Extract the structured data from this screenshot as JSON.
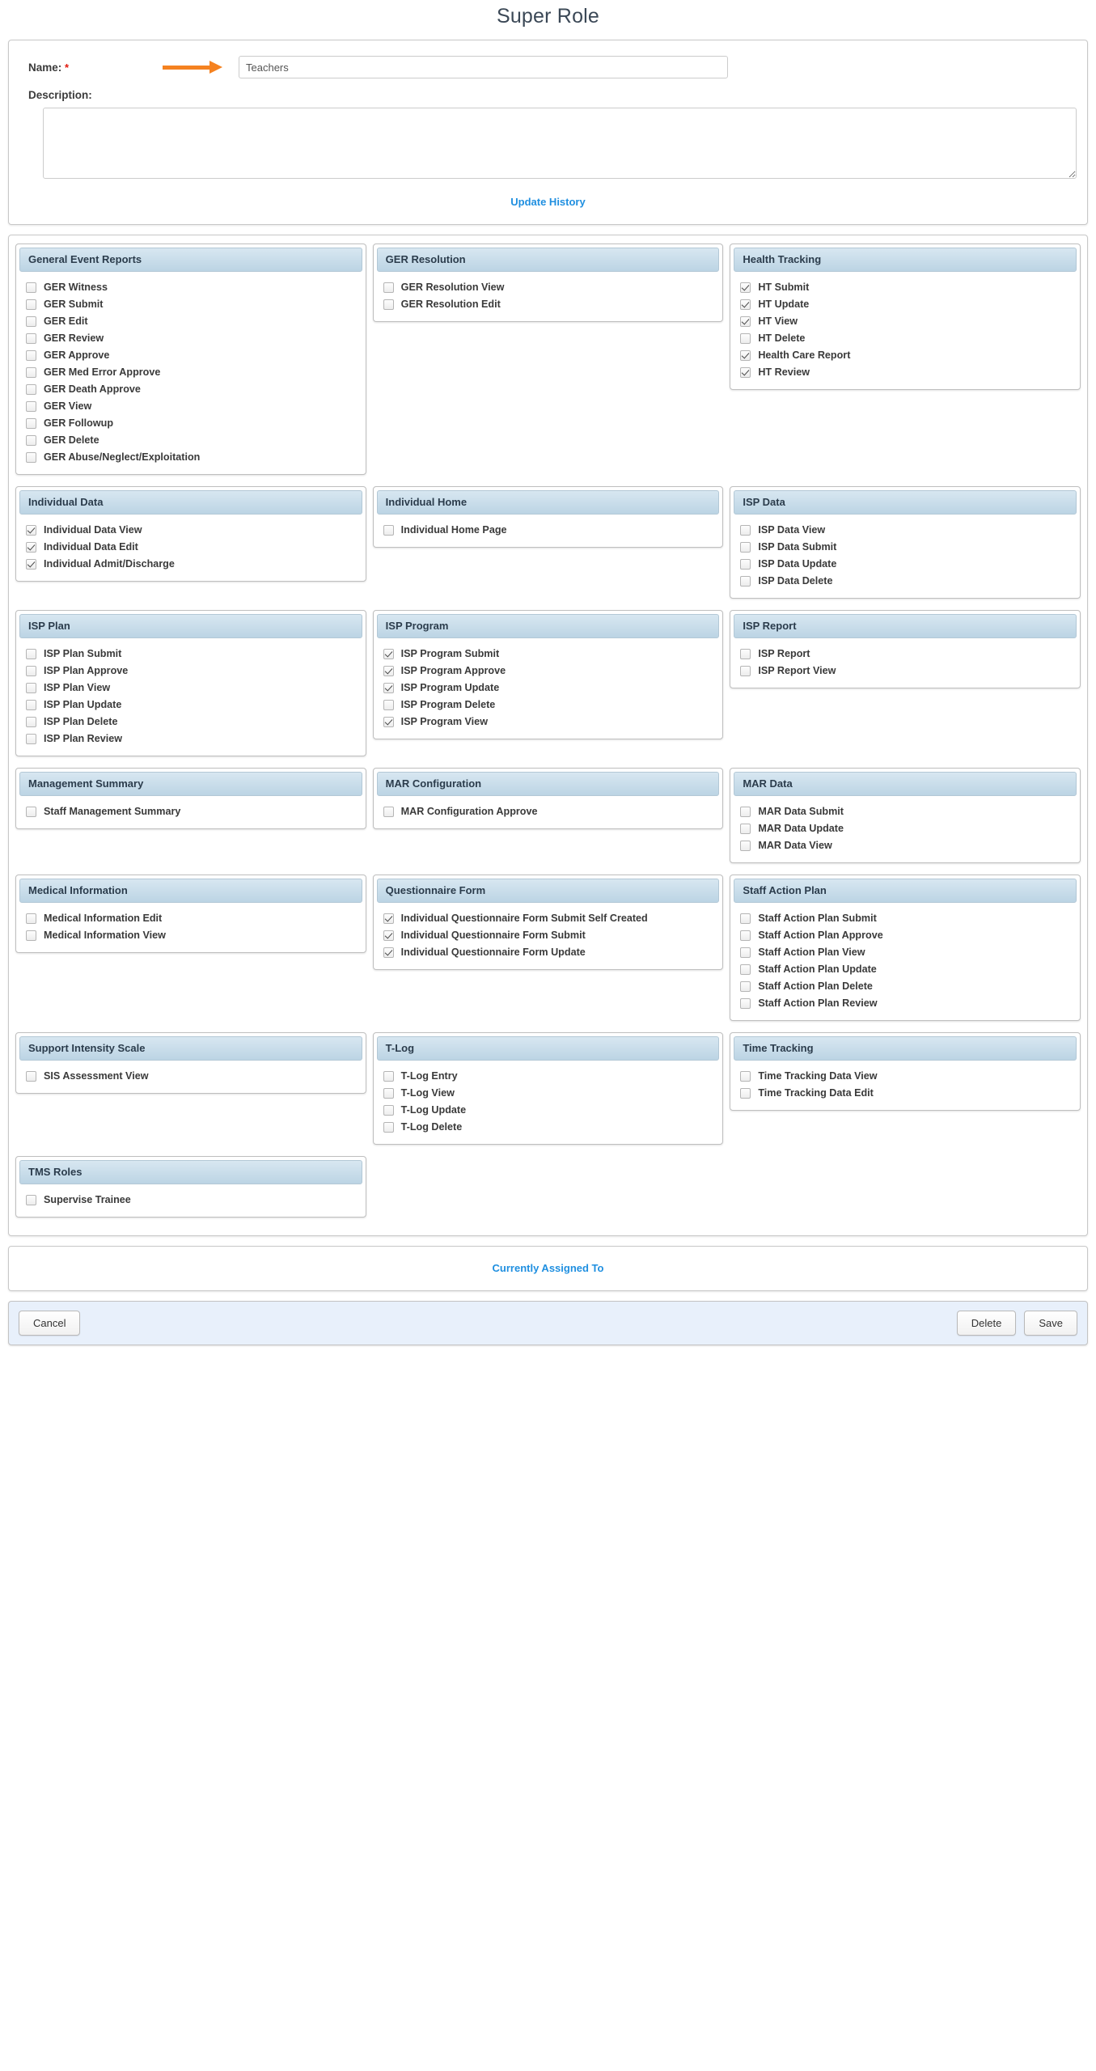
{
  "page": {
    "title": "Super Role"
  },
  "form": {
    "name_label": "Name:",
    "required_marker": "*",
    "name_value": "Teachers",
    "name_placeholder": "",
    "description_label": "Description:",
    "description_value": "",
    "description_placeholder": "",
    "update_history_link": "Update History"
  },
  "permission_groups": [
    {
      "title": "General Event Reports",
      "items": [
        {
          "label": "GER Witness",
          "checked": false
        },
        {
          "label": "GER Submit",
          "checked": false
        },
        {
          "label": "GER Edit",
          "checked": false
        },
        {
          "label": "GER Review",
          "checked": false
        },
        {
          "label": "GER Approve",
          "checked": false
        },
        {
          "label": "GER Med Error Approve",
          "checked": false
        },
        {
          "label": "GER Death Approve",
          "checked": false
        },
        {
          "label": "GER View",
          "checked": false
        },
        {
          "label": "GER Followup",
          "checked": false
        },
        {
          "label": "GER Delete",
          "checked": false
        },
        {
          "label": "GER Abuse/Neglect/Exploitation",
          "checked": false
        }
      ]
    },
    {
      "title": "GER Resolution",
      "items": [
        {
          "label": "GER Resolution View",
          "checked": false
        },
        {
          "label": "GER Resolution Edit",
          "checked": false
        }
      ]
    },
    {
      "title": "Health Tracking",
      "items": [
        {
          "label": "HT Submit",
          "checked": true
        },
        {
          "label": "HT Update",
          "checked": true
        },
        {
          "label": "HT View",
          "checked": true
        },
        {
          "label": "HT Delete",
          "checked": false
        },
        {
          "label": "Health Care Report",
          "checked": true
        },
        {
          "label": "HT Review",
          "checked": true
        }
      ]
    },
    {
      "title": "Individual Data",
      "items": [
        {
          "label": "Individual Data View",
          "checked": true
        },
        {
          "label": "Individual Data Edit",
          "checked": true
        },
        {
          "label": "Individual Admit/Discharge",
          "checked": true
        }
      ]
    },
    {
      "title": "Individual Home",
      "items": [
        {
          "label": "Individual Home Page",
          "checked": false
        }
      ]
    },
    {
      "title": "ISP Data",
      "items": [
        {
          "label": "ISP Data View",
          "checked": false
        },
        {
          "label": "ISP Data Submit",
          "checked": false
        },
        {
          "label": "ISP Data Update",
          "checked": false
        },
        {
          "label": "ISP Data Delete",
          "checked": false
        }
      ]
    },
    {
      "title": "ISP Plan",
      "items": [
        {
          "label": "ISP Plan Submit",
          "checked": false
        },
        {
          "label": "ISP Plan Approve",
          "checked": false
        },
        {
          "label": "ISP Plan View",
          "checked": false
        },
        {
          "label": "ISP Plan Update",
          "checked": false
        },
        {
          "label": "ISP Plan Delete",
          "checked": false
        },
        {
          "label": "ISP Plan Review",
          "checked": false
        }
      ]
    },
    {
      "title": "ISP Program",
      "items": [
        {
          "label": "ISP Program Submit",
          "checked": true
        },
        {
          "label": "ISP Program Approve",
          "checked": true
        },
        {
          "label": "ISP Program Update",
          "checked": true
        },
        {
          "label": "ISP Program Delete",
          "checked": false
        },
        {
          "label": "ISP Program View",
          "checked": true
        }
      ]
    },
    {
      "title": "ISP Report",
      "items": [
        {
          "label": "ISP Report",
          "checked": false
        },
        {
          "label": "ISP Report View",
          "checked": false
        }
      ]
    },
    {
      "title": "Management Summary",
      "items": [
        {
          "label": "Staff Management Summary",
          "checked": false
        }
      ]
    },
    {
      "title": "MAR Configuration",
      "items": [
        {
          "label": "MAR Configuration Approve",
          "checked": false
        }
      ]
    },
    {
      "title": "MAR Data",
      "items": [
        {
          "label": "MAR Data Submit",
          "checked": false
        },
        {
          "label": "MAR Data Update",
          "checked": false
        },
        {
          "label": "MAR Data View",
          "checked": false
        }
      ]
    },
    {
      "title": "Medical Information",
      "items": [
        {
          "label": "Medical Information Edit",
          "checked": false
        },
        {
          "label": "Medical Information View",
          "checked": false
        }
      ]
    },
    {
      "title": "Questionnaire Form",
      "items": [
        {
          "label": "Individual Questionnaire Form Submit Self Created",
          "checked": true
        },
        {
          "label": "Individual Questionnaire Form Submit",
          "checked": true
        },
        {
          "label": "Individual Questionnaire Form Update",
          "checked": true
        }
      ]
    },
    {
      "title": "Staff Action Plan",
      "items": [
        {
          "label": "Staff Action Plan Submit",
          "checked": false
        },
        {
          "label": "Staff Action Plan Approve",
          "checked": false
        },
        {
          "label": "Staff Action Plan View",
          "checked": false
        },
        {
          "label": "Staff Action Plan Update",
          "checked": false
        },
        {
          "label": "Staff Action Plan Delete",
          "checked": false
        },
        {
          "label": "Staff Action Plan Review",
          "checked": false
        }
      ]
    },
    {
      "title": "Support Intensity Scale",
      "items": [
        {
          "label": "SIS Assessment View",
          "checked": false
        }
      ]
    },
    {
      "title": "T-Log",
      "items": [
        {
          "label": "T-Log Entry",
          "checked": false
        },
        {
          "label": "T-Log View",
          "checked": false
        },
        {
          "label": "T-Log Update",
          "checked": false
        },
        {
          "label": "T-Log Delete",
          "checked": false
        }
      ]
    },
    {
      "title": "Time Tracking",
      "items": [
        {
          "label": "Time Tracking Data View",
          "checked": false
        },
        {
          "label": "Time Tracking Data Edit",
          "checked": false
        }
      ]
    },
    {
      "title": "TMS Roles",
      "items": [
        {
          "label": "Supervise Trainee",
          "checked": false
        }
      ]
    }
  ],
  "assigned": {
    "link_label": "Currently Assigned To"
  },
  "footer": {
    "cancel_label": "Cancel",
    "delete_label": "Delete",
    "save_label": "Save"
  },
  "colors": {
    "accent_link": "#1f8fe0",
    "required": "#e1190e",
    "arrow": "#f58220",
    "panel_header_top": "#d8e7f1",
    "panel_header_bottom": "#bcd4e4",
    "footer_bg": "#e8f0fb"
  }
}
